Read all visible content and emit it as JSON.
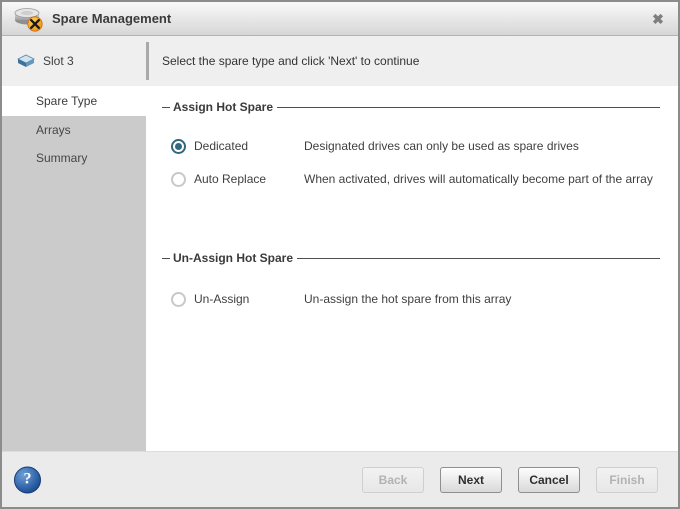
{
  "window": {
    "title": "Spare Management",
    "close_glyph": "✖"
  },
  "subheader": {
    "device_label": "Slot 3",
    "instruction": "Select the spare type and click 'Next' to continue"
  },
  "sidebar": {
    "items": [
      {
        "label": "Spare Type",
        "active": true
      },
      {
        "label": "Arrays",
        "active": false
      },
      {
        "label": "Summary",
        "active": false
      }
    ]
  },
  "sections": [
    {
      "title": "Assign Hot Spare",
      "options": [
        {
          "label": "Dedicated",
          "description": "Designated drives can only be used as spare drives",
          "selected": true
        },
        {
          "label": "Auto Replace",
          "description": "When activated, drives will automatically become part of the array",
          "selected": false
        }
      ]
    },
    {
      "title": "Un-Assign Hot Spare",
      "options": [
        {
          "label": "Un-Assign",
          "description": "Un-assign the hot spare from this array",
          "selected": false
        }
      ]
    }
  ],
  "footer": {
    "help_glyph": "?",
    "buttons": [
      {
        "label": "Back",
        "enabled": false
      },
      {
        "label": "Next",
        "enabled": true
      },
      {
        "label": "Cancel",
        "enabled": true
      },
      {
        "label": "Finish",
        "enabled": false
      }
    ]
  },
  "colors": {
    "radio_selected": "#33677b",
    "sidebar_bg": "#cbcbcb",
    "band_bg": "#efefef",
    "footer_bg": "#ebebeb",
    "help_blue": "#1d4f96",
    "badge_orange": "#f49a1c"
  }
}
